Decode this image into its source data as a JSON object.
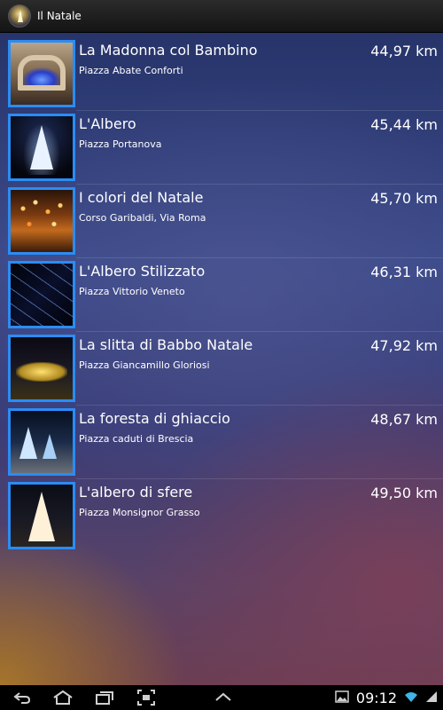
{
  "app": {
    "title": "Il Natale",
    "accent_color": "#2a8cf5"
  },
  "places": [
    {
      "title": "La Madonna col Bambino",
      "subtitle": "Piazza Abate Conforti",
      "distance": "44,97 km"
    },
    {
      "title": "L'Albero",
      "subtitle": "Piazza Portanova",
      "distance": "45,44 km"
    },
    {
      "title": "I colori del Natale",
      "subtitle": "Corso Garibaldi, Via Roma",
      "distance": "45,70 km"
    },
    {
      "title": "L'Albero Stilizzato",
      "subtitle": "Piazza Vittorio Veneto",
      "distance": "46,31 km"
    },
    {
      "title": "La slitta di Babbo Natale",
      "subtitle": "Piazza Giancamillo Gloriosi",
      "distance": "47,92 km"
    },
    {
      "title": "La foresta di ghiaccio",
      "subtitle": "Piazza caduti di Brescia",
      "distance": "48,67 km"
    },
    {
      "title": "L'albero di sfere",
      "subtitle": "Piazza Monsignor Grasso",
      "distance": "49,50 km"
    }
  ],
  "system_bar": {
    "time": "09:12",
    "icons": [
      "back-icon",
      "home-icon",
      "recent-apps-icon",
      "screenshot-icon",
      "up-arrow-icon",
      "gallery-icon",
      "wifi-icon",
      "signal-icon"
    ]
  }
}
